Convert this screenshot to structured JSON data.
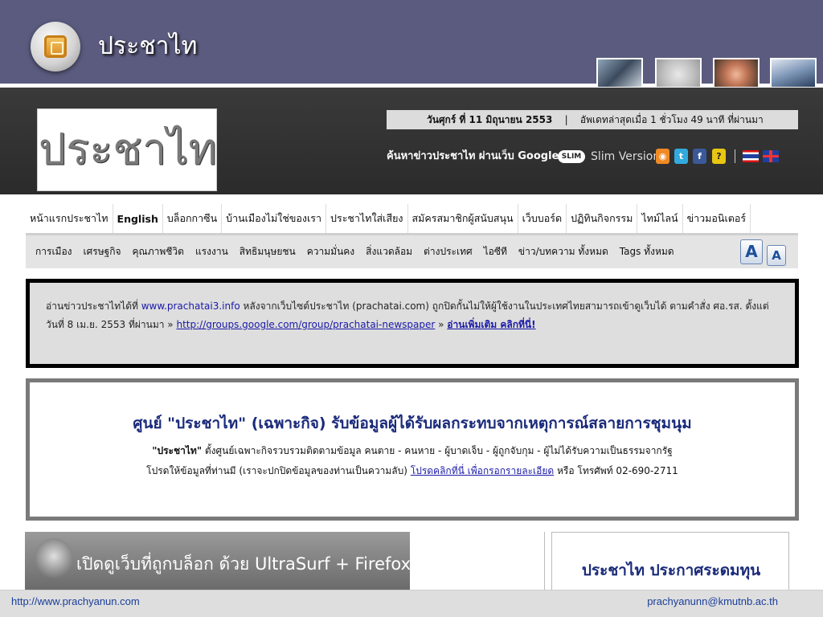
{
  "slide": {
    "title": "ประชาไท",
    "footer_left": "http://www.prachyanun.com",
    "footer_right": "prachyanunn@kmutnb.ac.th",
    "colors": {
      "title_bar": "#5b5b7f",
      "link": "#1a1aa8",
      "heading": "#1a2a7a"
    }
  },
  "site": {
    "logo_text": "ประชาไท",
    "date_label": "วันศุกร์ ที่ 11 มิถุนายน 2553",
    "date_separator": "|",
    "update_text": "อัพเดทล่าสุดเมื่อ 1 ชั่วโมง 49 นาที ที่ผ่านมา",
    "search_label": "ค้นหาข่าวประชาไท ผ่านเว็บ Google",
    "slim_badge": "SLIM",
    "slim_label": "Slim Version",
    "icons": {
      "rss": "rss-icon",
      "twitter": "twitter-icon",
      "facebook": "facebook-icon",
      "help": "help-icon"
    },
    "icon_glyphs": {
      "rss": "◉",
      "twitter": "t",
      "facebook": "f",
      "help": "?"
    },
    "separator": "|"
  },
  "nav": {
    "main": [
      "หน้าแรกประชาไท",
      "English",
      "บล็อกกาซีน",
      "บ้านเมืองไม่ใช่ของเรา",
      "ประชาไทใส่เสียง",
      "สมัครสมาชิกผู้สนับสนุน",
      "เว็บบอร์ด",
      "ปฏิทินกิจกรรม",
      "ไทม์ไลน์",
      "ข่าวมอนิเตอร์"
    ],
    "sub": [
      "การเมือง",
      "เศรษฐกิจ",
      "คุณภาพชีวิต",
      "แรงงาน",
      "สิทธิมนุษยชน",
      "ความมั่นคง",
      "สิ่งแวดล้อม",
      "ต่างประเทศ",
      "ไอซีที",
      "ข่าว/บทความ ทั้งหมด",
      "Tags ทั้งหมด"
    ],
    "font_larger": "A",
    "font_smaller": "A"
  },
  "notice": {
    "text1": "อ่านข่าวประชาไทได้ที่ ",
    "link1": "www.prachatai3.info",
    "text2": " หลังจากเว็บไซต์ประชาไท (prachatai.com) ถูกปิดกั้นไม่ให้ผู้ใช้งานในประเทศไทยสามารถเข้าดูเว็บได้ ตามคำสั่ง ศอ.รส. ตั้งแต่วันที่ 8 เม.ย. 2553 ที่ผ่านมา » ",
    "link2": "http://groups.google.com/group/prachatai-newspaper",
    "text3": " » ",
    "link3": "อ่านเพิ่มเติม คลิกที่นี่!"
  },
  "center": {
    "heading": "ศูนย์ \"ประชาไท\" (เฉพาะกิจ) รับข้อมูลผู้ได้รับผลกระทบจากเหตุการณ์สลายการชุมนุม",
    "line1_bold": "\"ประชาไท\"",
    "line1_rest": " ตั้งศูนย์เฉพาะกิจรวบรวมติดตามข้อมูล คนตาย - คนหาย - ผู้บาดเจ็บ - ผู้ถูกจับกุม - ผู้ไม่ได้รับความเป็นธรรมจากรัฐ",
    "line2_pre": "โปรดให้ข้อมูลที่ท่านมี (เราจะปกปิดข้อมูลของท่านเป็นความลับ) ",
    "line2_link": "โปรดคลิกที่นี่ เพื่อกรอกรายละเอียด",
    "line2_post": " หรือ โทรศัพท์ 02-690-2711"
  },
  "bottom": {
    "banner_text": "เปิดดูเว็บที่ถูกบล็อก ด้วย UltraSurf + Firefox",
    "right_heading": "ประชาไท ประกาศระดมทุน"
  }
}
